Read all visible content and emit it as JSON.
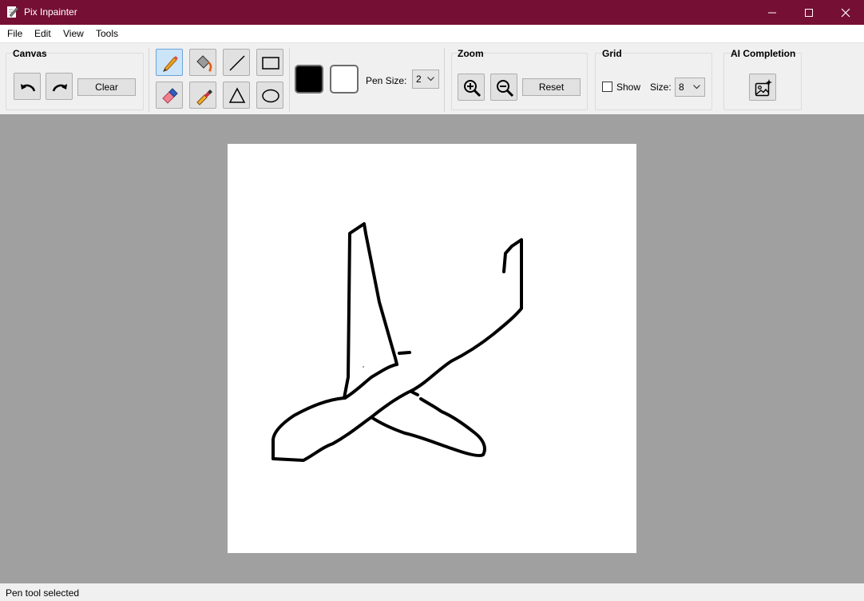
{
  "window": {
    "title": "Pix Inpainter",
    "icons": [
      "app-icon",
      "minimize-icon",
      "maximize-icon",
      "close-icon"
    ]
  },
  "menu": [
    "File",
    "Edit",
    "View",
    "Tools"
  ],
  "toolbar": {
    "canvas_group": {
      "title": "Canvas",
      "undo_icon": "undo-icon",
      "redo_icon": "redo-icon",
      "clear_label": "Clear"
    },
    "tools": [
      {
        "name": "pen",
        "icon": "pencil-icon",
        "active": true
      },
      {
        "name": "fill",
        "icon": "paint-bucket-icon",
        "active": false
      },
      {
        "name": "line",
        "icon": "line-icon",
        "active": false
      },
      {
        "name": "rectangle",
        "icon": "rectangle-icon",
        "active": false
      },
      {
        "name": "eraser",
        "icon": "eraser-icon",
        "active": false
      },
      {
        "name": "eyedropper",
        "icon": "eyedropper-icon",
        "active": false
      },
      {
        "name": "triangle",
        "icon": "triangle-icon",
        "active": false
      },
      {
        "name": "ellipse",
        "icon": "ellipse-icon",
        "active": false
      }
    ],
    "colors": {
      "primary": "#000000",
      "secondary": "#ffffff"
    },
    "pen_size": {
      "label": "Pen Size:",
      "value": "2"
    },
    "zoom_group": {
      "title": "Zoom",
      "zoom_in_icon": "zoom-in-icon",
      "zoom_out_icon": "zoom-out-icon",
      "reset_label": "Reset"
    },
    "grid_group": {
      "title": "Grid",
      "show_label": "Show",
      "show_checked": false,
      "size_label": "Size:",
      "size_value": "8"
    },
    "ai_group": {
      "title": "AI Completion",
      "icon": "ai-image-icon"
    }
  },
  "canvas": {
    "background": "#ffffff",
    "workspace_color": "#a0a0a0",
    "drawing": "airplane sketch"
  },
  "status": {
    "text": "Pen tool selected"
  },
  "theme": {
    "titlebar": "#750f33",
    "active_tool": "#cce4f7"
  }
}
